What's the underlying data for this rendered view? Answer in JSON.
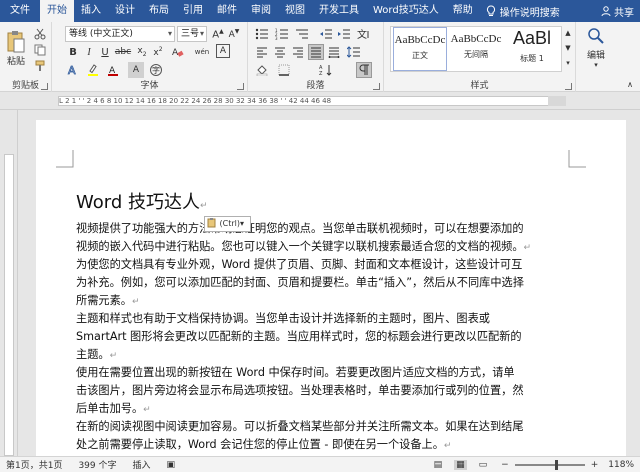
{
  "tabs": {
    "file": "文件",
    "items": [
      "开始",
      "插入",
      "设计",
      "布局",
      "引用",
      "邮件",
      "审阅",
      "视图",
      "开发工具",
      "Word技巧达人",
      "帮助"
    ],
    "active_index": 0,
    "tell_me": "操作说明搜索",
    "share": "共享"
  },
  "ribbon": {
    "clipboard": {
      "label": "剪贴板",
      "paste": "粘贴"
    },
    "font": {
      "label": "字体",
      "font_name": "等线 (中文正文)",
      "font_size": "三号",
      "wen": "wén",
      "font_color": "#c00000",
      "highlight_color": "#ffff00"
    },
    "paragraph": {
      "label": "段落"
    },
    "styles": {
      "label": "样式",
      "items": [
        {
          "sample": "AaBbCcDc",
          "name": "正文"
        },
        {
          "sample": "AaBbCcDc",
          "name": "无间隔"
        },
        {
          "sample": "AaBl",
          "name": "标题 1"
        }
      ]
    },
    "editing": {
      "label": "编辑"
    }
  },
  "ruler": {
    "ticks": "L 2 1 ' ' 2 4 6 8 10 12 14 16 18 20 22 24 26 28 30 32 34 36 38 ' ' 42 44 46 48"
  },
  "document": {
    "title": "Word 技巧达人",
    "paste_options": "(Ctrl)",
    "paragraphs": [
      [
        "视频提供了功能强大的方法帮助您证明您的观点。当您单击联机视频时，可以在想要添加的",
        "视频的嵌入代码中进行粘贴。您也可以键入一个关键字以联机搜索最适合您的文档的视频。"
      ],
      [
        "为使您的文档具有专业外观，Word 提供了页眉、页脚、封面和文本框设计，这些设计可互",
        "为补充。例如，您可以添加匹配的封面、页眉和提要栏。单击“插入”，然后从不同库中选择",
        "所需元素。"
      ],
      [
        "主题和样式也有助于文档保持协调。当您单击设计并选择新的主题时，图片、图表或",
        "SmartArt 图形将会更改以匹配新的主题。当应用样式时，您的标题会进行更改以匹配新的",
        "主题。"
      ],
      [
        "使用在需要位置出现的新按钮在 Word 中保存时间。若要更改图片适应文档的方式，请单",
        "击该图片，图片旁边将会显示布局选项按钮。当处理表格时，单击要添加行或列的位置，然",
        "后单击加号。"
      ],
      [
        "在新的阅读视图中阅读更加容易。可以折叠文档某些部分并关注所需文本。如果在达到结尾",
        "处之前需要停止读取，Word 会记住您的停止位置 - 即使在另一个设备上。"
      ]
    ]
  },
  "statusbar": {
    "page": "第1页，共1页",
    "words": "399 个字",
    "mode": "插入",
    "zoom": "118%"
  },
  "colors": {
    "brand": "#2b579a",
    "status_bg": "#f3f3f3"
  }
}
